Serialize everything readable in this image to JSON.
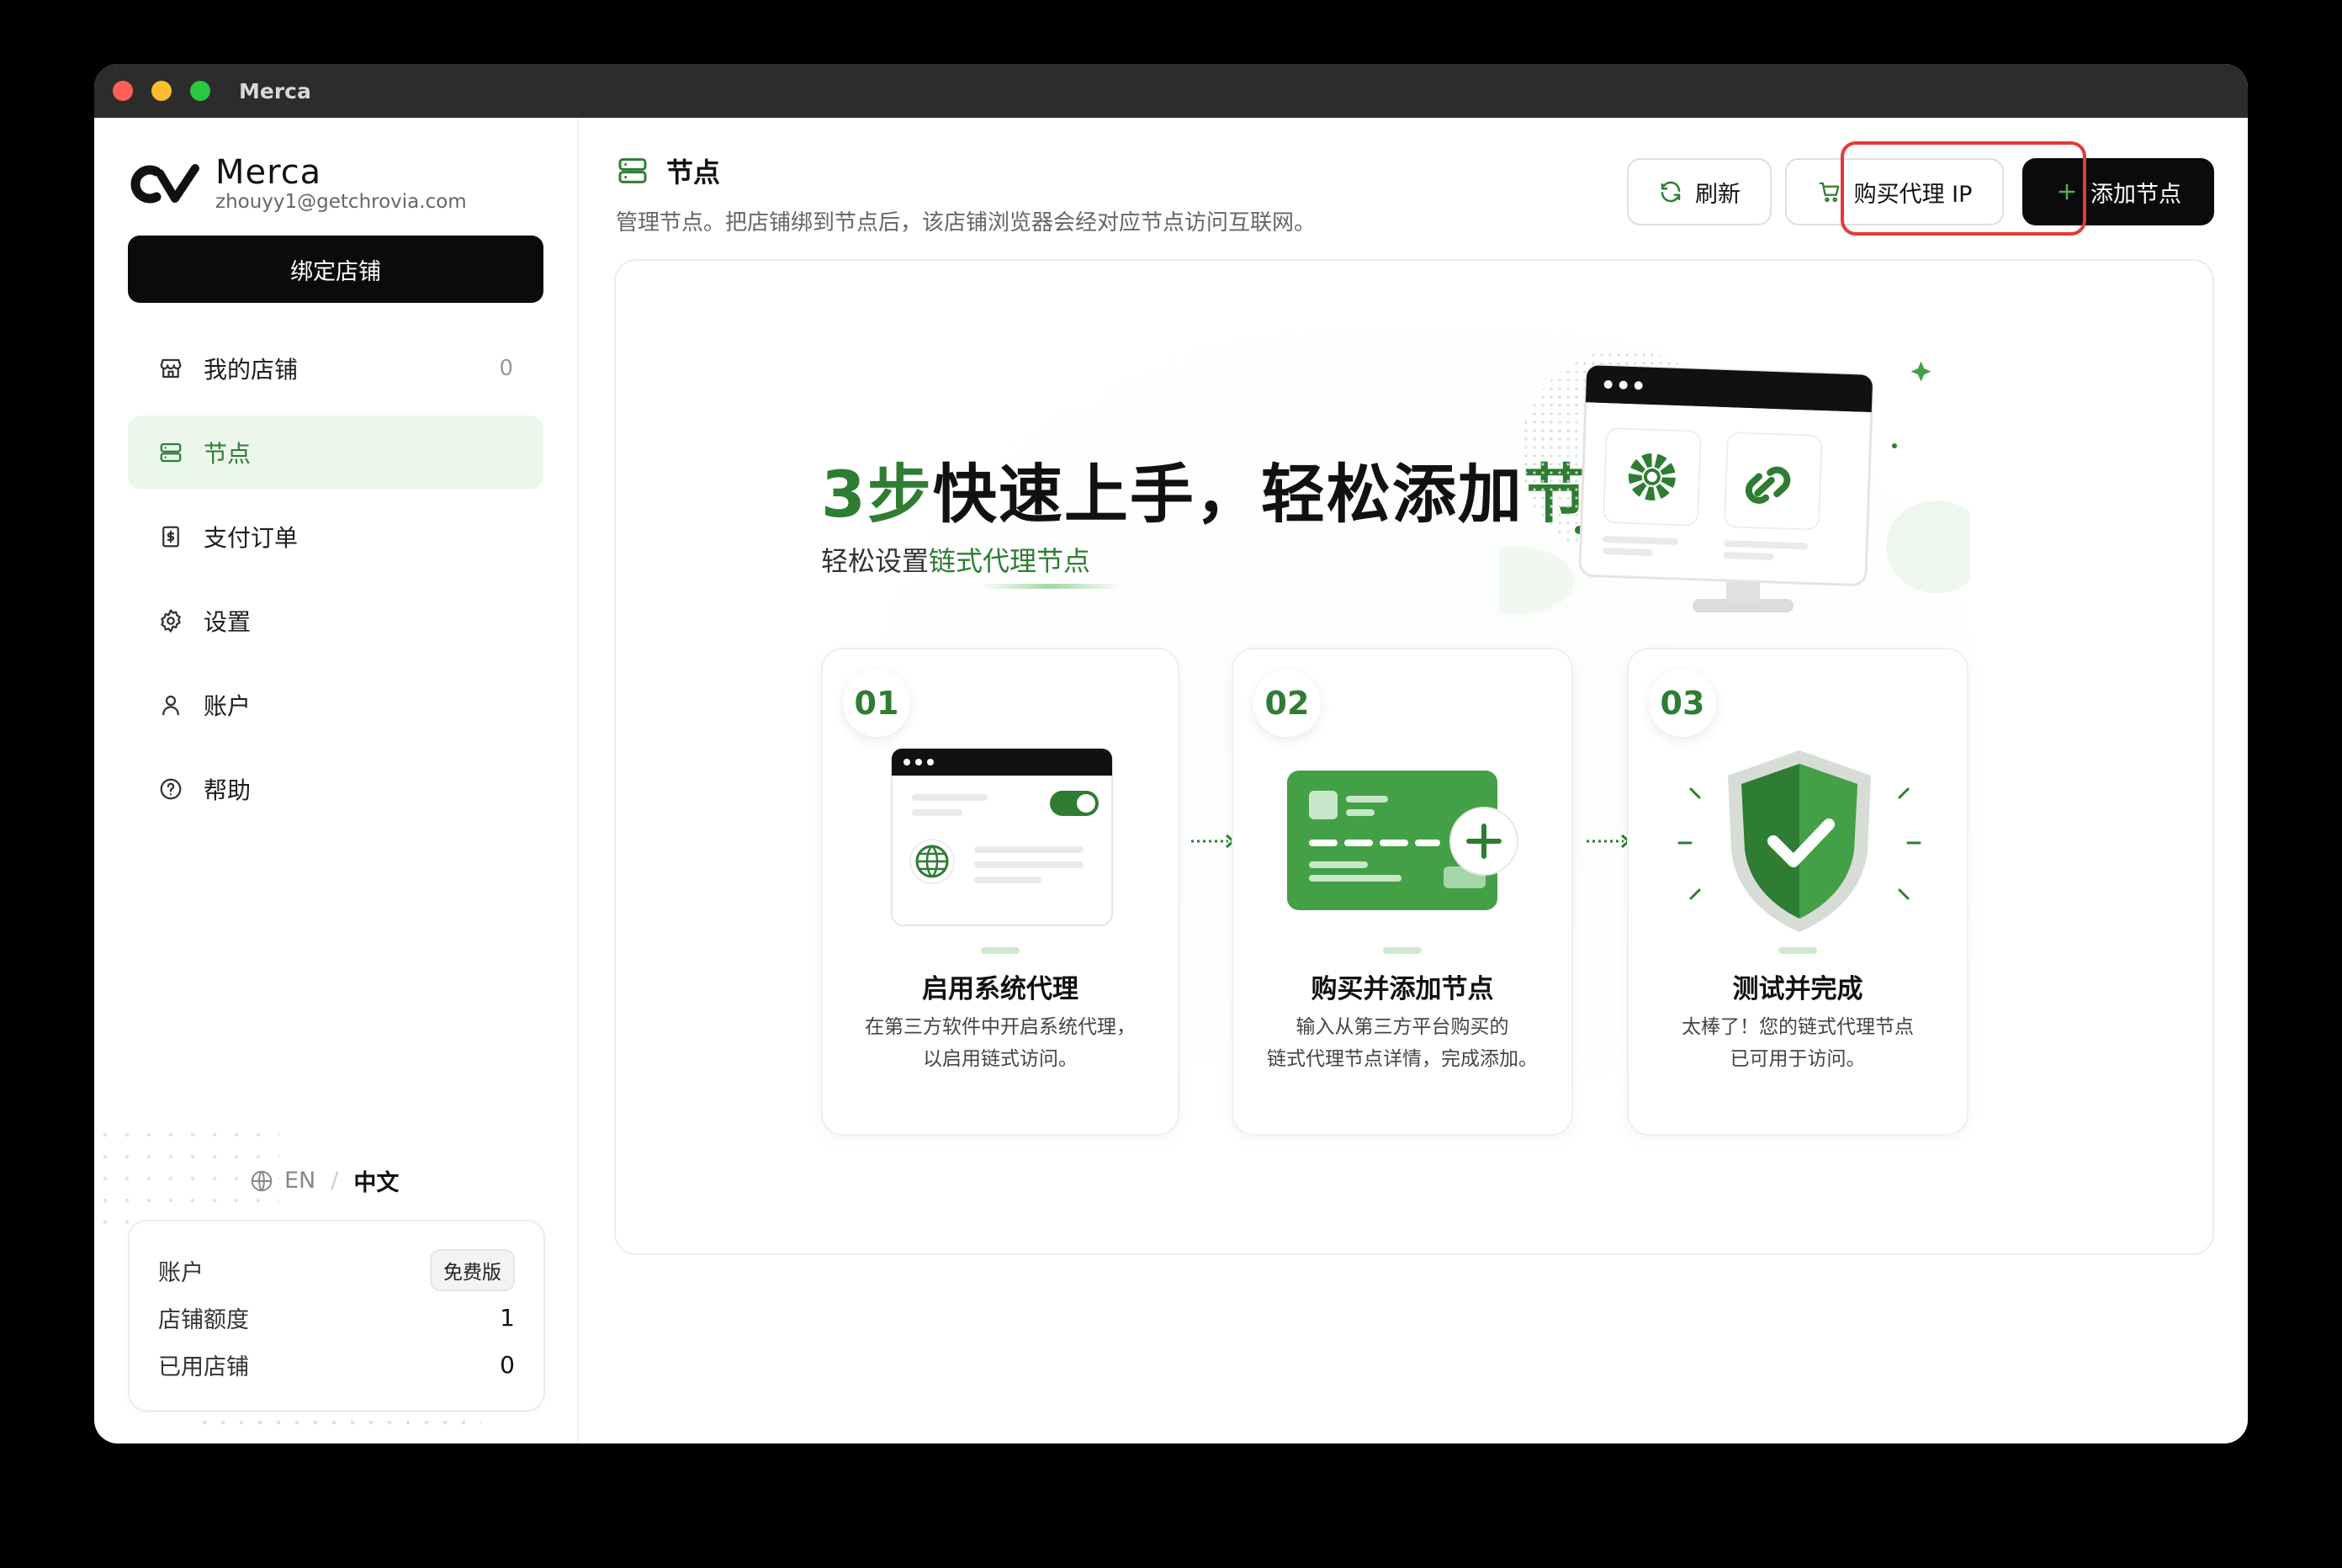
{
  "window": {
    "title": "Merca"
  },
  "brand": {
    "name": "Merca",
    "email": "zhouyy1@getchrovia.com"
  },
  "sidebar": {
    "bind_label": "绑定店铺",
    "items": [
      {
        "label": "我的店铺",
        "count": "0",
        "icon": "store-icon"
      },
      {
        "label": "节点",
        "icon": "server-icon",
        "active": true
      },
      {
        "label": "支付订单",
        "icon": "receipt-icon"
      },
      {
        "label": "设置",
        "icon": "gear-icon"
      },
      {
        "label": "账户",
        "icon": "user-icon"
      },
      {
        "label": "帮助",
        "icon": "help-icon"
      }
    ],
    "lang": {
      "en": "EN",
      "sep": "/",
      "zh": "中文"
    }
  },
  "account": {
    "title": "账户",
    "plan": "免费版",
    "quota_label": "店铺额度",
    "quota_value": "1",
    "used_label": "已用店铺",
    "used_value": "0"
  },
  "page": {
    "title": "节点",
    "desc": "管理节点。把店铺绑到节点后，该店铺浏览器会经对应节点访问互联网。"
  },
  "actions": {
    "refresh": "刷新",
    "buy": "购买代理 IP",
    "add": "添加节点"
  },
  "hero": {
    "title_a": "3步",
    "title_b": "快速上手，轻松添加",
    "title_c": "节点",
    "sub_a": "轻松设置",
    "sub_b": "链式代理节点"
  },
  "steps": [
    {
      "num": "01",
      "title": "启用系统代理",
      "desc1": "在第三方软件中开启系统代理，",
      "desc2": "以启用链式访问。"
    },
    {
      "num": "02",
      "title": "购买并添加节点",
      "desc1": "输入从第三方平台购买的",
      "desc2": "链式代理节点详情，完成添加。"
    },
    {
      "num": "03",
      "title": "测试并完成",
      "desc1": "太棒了！您的链式代理节点",
      "desc2": "已可用于访问。"
    }
  ],
  "colors": {
    "accent": "#2e7d32",
    "accent_light": "#ecf7ec",
    "highlight": "#e53935",
    "dark": "#0b0b0b"
  }
}
